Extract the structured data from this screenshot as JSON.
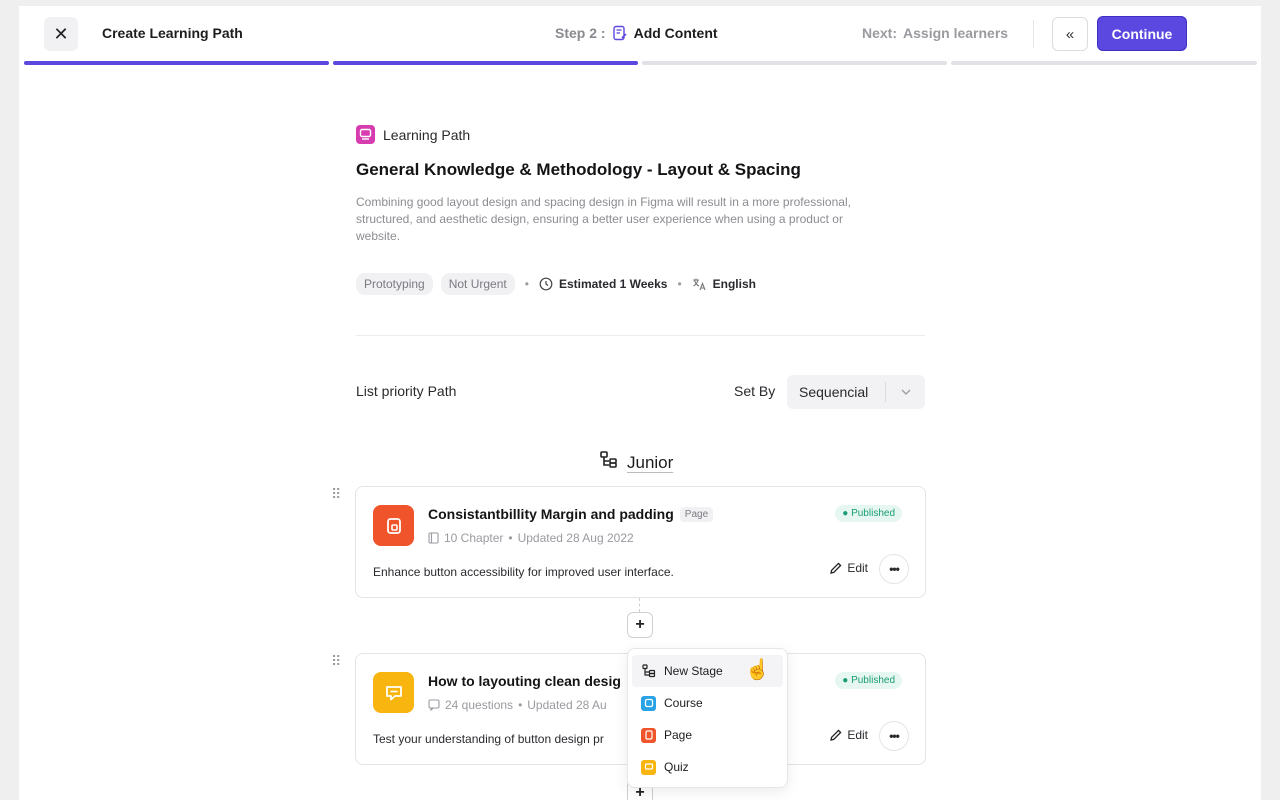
{
  "header": {
    "title": "Create Learning Path",
    "step_prefix": "Step 2 :",
    "step_name": "Add Content",
    "next_prefix": "Next:",
    "next_name": "Assign learners",
    "back_icon": "«",
    "continue_label": "Continue",
    "close_icon": "✕",
    "progress": [
      1,
      1,
      0,
      0
    ]
  },
  "path": {
    "type_label": "Learning Path",
    "title": "General Knowledge & Methodology - Layout & Spacing",
    "description": "Combining good layout design and spacing design in Figma will result in a more professional, structured, and aesthetic design, ensuring a better user experience when using a product or website.",
    "tags": [
      "Prototyping",
      "Not Urgent"
    ],
    "estimated": "Estimated 1 Weeks",
    "language": "English"
  },
  "priority": {
    "label": "List priority Path",
    "set_by_label": "Set By",
    "select_value": "Sequencial"
  },
  "stage": {
    "name": "Junior"
  },
  "cards": [
    {
      "title": "Consistantbillity Margin and padding",
      "badge": "Page",
      "sub_count": "10 Chapter",
      "sub_updated": "Updated 28 Aug 2022",
      "status": "Published",
      "description": "Enhance button accessibility for improved user interface.",
      "edit_label": "Edit",
      "more_icon": "•••",
      "icon_color": "#f0542b"
    },
    {
      "title": "How to layouting clean desig",
      "sub_count": "24 questions",
      "sub_updated": "Updated 28 Au",
      "status": "Published",
      "description": "Test your understanding of button design pr",
      "edit_label": "Edit",
      "more_icon": "•••",
      "icon_color": "#f8b40f"
    }
  ],
  "add_menu": {
    "plus": "+",
    "items": [
      {
        "label": "New Stage",
        "icon": "stage-icon"
      },
      {
        "label": "Course",
        "icon": "course-icon",
        "color": "#2aa3e6"
      },
      {
        "label": "Page",
        "icon": "page-icon",
        "color": "#f0542b"
      },
      {
        "label": "Quiz",
        "icon": "quiz-icon",
        "color": "#f8b40f"
      }
    ]
  },
  "colors": {
    "accent": "#5a48e0",
    "published_text": "#1a9c76",
    "published_bg": "#e6f7f1",
    "learning_path_icon": "#d63bb0"
  }
}
